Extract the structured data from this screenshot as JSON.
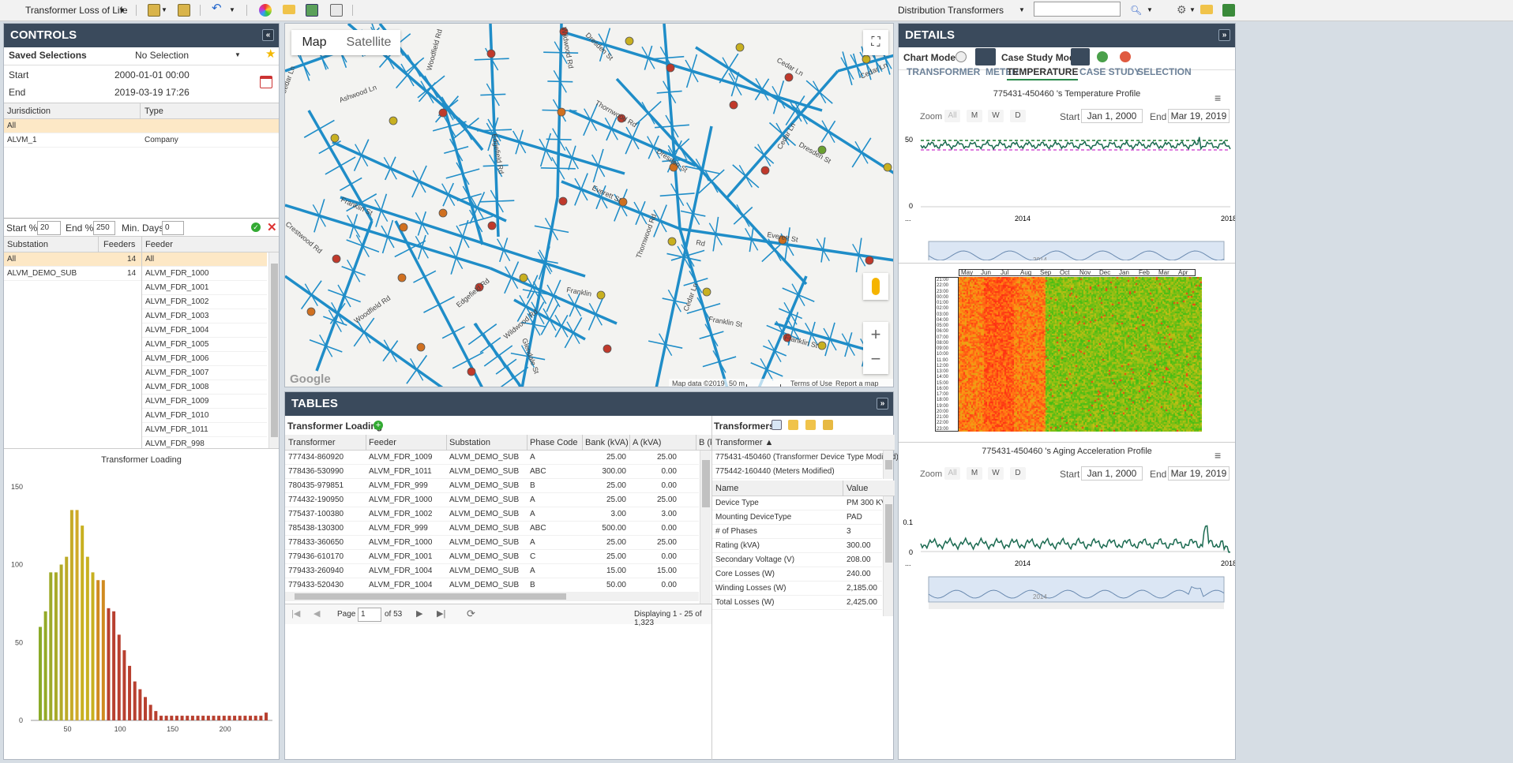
{
  "toolbar": {
    "app_title": "Transformer Loss of Life",
    "dataset": "Distribution Transformers",
    "search_value": ""
  },
  "controls": {
    "title": "CONTROLS",
    "saved_label": "Saved Selections",
    "saved_value": "No Selection",
    "start_label": "Start",
    "start_value": "2000-01-01 00:00",
    "end_label": "End",
    "end_value": "2019-03-19 17:26",
    "jur_headers": [
      "Jurisdiction",
      "Type"
    ],
    "jur_rows": [
      [
        "All",
        ""
      ],
      [
        "ALVM_1",
        "Company"
      ]
    ],
    "start_pct_label": "Start %",
    "start_pct": "20",
    "end_pct_label": "End %",
    "end_pct": "250",
    "min_days_label": "Min. Days",
    "min_days": "0",
    "sub_headers": [
      "Substation",
      "Feeders"
    ],
    "sub_rows": [
      [
        "All",
        "14"
      ],
      [
        "ALVM_DEMO_SUB",
        "14"
      ]
    ],
    "feeder_header": "Feeder",
    "feeders": [
      "All",
      "ALVM_FDR_1000",
      "ALVM_FDR_1001",
      "ALVM_FDR_1002",
      "ALVM_FDR_1003",
      "ALVM_FDR_1004",
      "ALVM_FDR_1005",
      "ALVM_FDR_1006",
      "ALVM_FDR_1007",
      "ALVM_FDR_1008",
      "ALVM_FDR_1009",
      "ALVM_FDR_1010",
      "ALVM_FDR_1011",
      "ALVM_FDR_998"
    ]
  },
  "hist": {
    "title": "Transformer Loading",
    "yticks": [
      "150",
      "100",
      "50",
      "0"
    ],
    "xticks": [
      "50",
      "100",
      "150",
      "200"
    ]
  },
  "chart_data": {
    "type": "bar",
    "title": "Transformer Loading",
    "x": [
      24,
      29,
      34,
      39,
      44,
      49,
      54,
      59,
      64,
      69,
      74,
      79,
      84,
      89,
      94,
      99,
      104,
      109,
      114,
      119,
      124,
      129,
      134,
      139,
      144,
      149,
      154,
      159,
      164,
      169,
      174,
      179,
      184,
      189,
      194,
      199,
      204,
      209,
      214,
      219,
      224,
      229,
      234,
      239
    ],
    "values": [
      60,
      70,
      95,
      95,
      100,
      105,
      135,
      135,
      125,
      105,
      95,
      90,
      90,
      72,
      70,
      55,
      45,
      35,
      25,
      20,
      15,
      10,
      6,
      3,
      3,
      3,
      3,
      3,
      3,
      3,
      3,
      3,
      3,
      3,
      3,
      3,
      3,
      3,
      3,
      3,
      3,
      3,
      3,
      5
    ],
    "ylim": [
      0,
      160
    ],
    "xlim": [
      15,
      245
    ]
  },
  "map": {
    "tab_map": "Map",
    "tab_satellite": "Satellite",
    "attribution": "Map data ©2019",
    "scale": "50 m",
    "terms": "Terms of Use",
    "report": "Report a map error",
    "google": "Google",
    "streets": [
      "Woodfield Rd",
      "Ashwood Ln",
      "Edgefield Rd",
      "Wildwood Rd",
      "Dresden St",
      "Cedar Ln",
      "Thornwood Rd",
      "Everett St",
      "Franklin St",
      "Crestwood Rd",
      "Cedar Ln",
      "Dresden St",
      "Everett St",
      "Franklin",
      "Thornwood Rd",
      "Cedar Ln",
      "Franklin St",
      "Franklin St",
      "Woodfield Rd",
      "Edgefield Rd",
      "Wildwood Rd",
      "Glendale St",
      "Cedar Ln",
      "Dresden St",
      "Cedar Ln",
      "Rd"
    ]
  },
  "tables": {
    "title": "TABLES",
    "tl_title": "Transformer Loading",
    "tl_headers": [
      "Transformer",
      "Feeder",
      "Substation",
      "Phase Code",
      "Bank (kVA)",
      "A (kVA)",
      "B (k"
    ],
    "tl_rows": [
      [
        "777434-860920",
        "ALVM_FDR_1009",
        "ALVM_DEMO_SUB",
        "A",
        "25.00",
        "25.00"
      ],
      [
        "778436-530990",
        "ALVM_FDR_1011",
        "ALVM_DEMO_SUB",
        "ABC",
        "300.00",
        "0.00"
      ],
      [
        "780435-979851",
        "ALVM_FDR_999",
        "ALVM_DEMO_SUB",
        "B",
        "25.00",
        "0.00"
      ],
      [
        "774432-190950",
        "ALVM_FDR_1000",
        "ALVM_DEMO_SUB",
        "A",
        "25.00",
        "25.00"
      ],
      [
        "775437-100380",
        "ALVM_FDR_1002",
        "ALVM_DEMO_SUB",
        "A",
        "3.00",
        "3.00"
      ],
      [
        "785438-130300",
        "ALVM_FDR_999",
        "ALVM_DEMO_SUB",
        "ABC",
        "500.00",
        "0.00"
      ],
      [
        "778433-360650",
        "ALVM_FDR_1000",
        "ALVM_DEMO_SUB",
        "A",
        "25.00",
        "25.00"
      ],
      [
        "779436-610170",
        "ALVM_FDR_1001",
        "ALVM_DEMO_SUB",
        "C",
        "25.00",
        "0.00"
      ],
      [
        "779433-260940",
        "ALVM_FDR_1004",
        "ALVM_DEMO_SUB",
        "A",
        "15.00",
        "15.00"
      ],
      [
        "779433-520430",
        "ALVM_FDR_1004",
        "ALVM_DEMO_SUB",
        "B",
        "50.00",
        "0.00"
      ]
    ],
    "page_label": "Page",
    "page_value": "1",
    "page_of": "of 53",
    "displaying": "Displaying 1 - 25 of 1,323",
    "tr_title": "Transformers",
    "tr_header": "Transformer ▲",
    "tr_rows": [
      "775431-450460 (Transformer Device Type Modified)",
      "775442-160440 (Meters Modified)"
    ],
    "prop_headers": [
      "Name",
      "Value"
    ],
    "props": [
      [
        "Device Type",
        "PM 300 KVA"
      ],
      [
        "Mounting DeviceType",
        "PAD"
      ],
      [
        "# of Phases",
        "3"
      ],
      [
        "Rating (kVA)",
        "300.00"
      ],
      [
        "Secondary Voltage (V)",
        "208.00"
      ],
      [
        "Core Losses (W)",
        "240.00"
      ],
      [
        "Winding Losses (W)",
        "2,185.00"
      ],
      [
        "Total Losses (W)",
        "2,425.00"
      ]
    ]
  },
  "details": {
    "title": "DETAILS",
    "chart_mode": "Chart Mode",
    "case_mode": "Case Study Mode",
    "tabs": [
      "TRANSFORMER",
      "METER",
      "TEMPERATURE",
      "CASE STUDY",
      "SELECTION"
    ],
    "temp_title": "775431-450460 's Temperature Profile",
    "zoom": "Zoom",
    "zbtns": [
      "All",
      "M",
      "W",
      "D"
    ],
    "start_label": "Start",
    "start": "Jan 1, 2000",
    "end_label": "End",
    "end": "Mar 19, 2019",
    "temp_yticks": [
      "50",
      "0"
    ],
    "xtick1": "2014",
    "xtick2": "2018",
    "nav_label": "2014",
    "ellipsis": "...",
    "heat_months": [
      "May",
      "Jun",
      "Jul",
      "Aug",
      "Sep",
      "Oct",
      "Nov",
      "Dec",
      "Jan",
      "Feb",
      "Mar",
      "Apr"
    ],
    "heat_hours": [
      "21:00",
      "22:00",
      "23:00",
      "00:00",
      "01:00",
      "02:00",
      "03:00",
      "04:00",
      "05:00",
      "06:00",
      "07:00",
      "08:00",
      "09:00",
      "10:00",
      "11:00",
      "12:00",
      "13:00",
      "14:00",
      "15:00",
      "16:00",
      "17:00",
      "18:00",
      "19:00",
      "20:00",
      "21:00",
      "22:00",
      "23:00"
    ],
    "aging_title": "775431-450460 's Aging Acceleration Profile",
    "aging_yticks": [
      "0.1",
      "0"
    ]
  }
}
